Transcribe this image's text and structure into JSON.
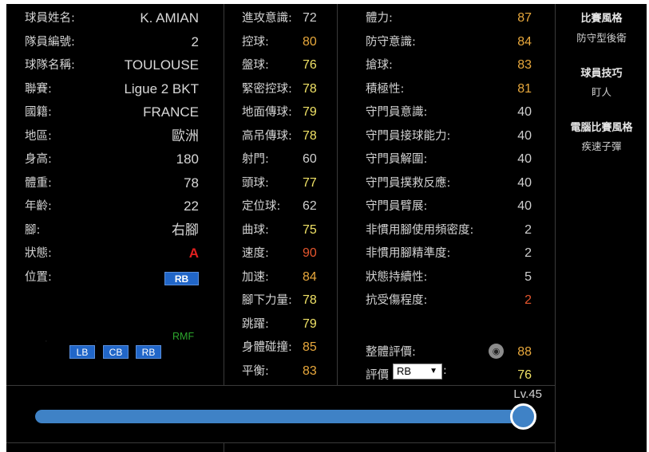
{
  "player_info": [
    {
      "label": "球員姓名:",
      "value": "K. AMIAN"
    },
    {
      "label": "隊員編號:",
      "value": "2"
    },
    {
      "label": "球隊名稱:",
      "value": "TOULOUSE"
    },
    {
      "label": "聯賽:",
      "value": "Ligue 2 BKT"
    },
    {
      "label": "國籍:",
      "value": "FRANCE"
    },
    {
      "label": "地區:",
      "value": "歐洲"
    },
    {
      "label": "身高:",
      "value": "180"
    },
    {
      "label": "體重:",
      "value": "78"
    },
    {
      "label": "年齡:",
      "value": "22"
    },
    {
      "label": "腳:",
      "value": "右腳"
    },
    {
      "label": "狀態:",
      "value": "A"
    },
    {
      "label": "位置:",
      "value": "RB"
    }
  ],
  "positions": {
    "highlight": "RMF",
    "badges": [
      "LB",
      "CB",
      "RB"
    ]
  },
  "attack_stats": [
    {
      "label": "進攻意識:",
      "value": "72"
    },
    {
      "label": "控球:",
      "value": "80"
    },
    {
      "label": "盤球:",
      "value": "76"
    },
    {
      "label": "緊密控球:",
      "value": "78"
    },
    {
      "label": "地面傳球:",
      "value": "79"
    },
    {
      "label": "高吊傳球:",
      "value": "78"
    },
    {
      "label": "射門:",
      "value": "60"
    },
    {
      "label": "頭球:",
      "value": "77"
    },
    {
      "label": "定位球:",
      "value": "62"
    },
    {
      "label": "曲球:",
      "value": "75"
    },
    {
      "label": "速度:",
      "value": "90"
    },
    {
      "label": "加速:",
      "value": "84"
    },
    {
      "label": "腳下力量:",
      "value": "78"
    },
    {
      "label": "跳躍:",
      "value": "79"
    },
    {
      "label": "身體碰撞:",
      "value": "85"
    },
    {
      "label": "平衡:",
      "value": "83"
    }
  ],
  "defense_stats": [
    {
      "label": "體力:",
      "value": "87"
    },
    {
      "label": "防守意識:",
      "value": "84"
    },
    {
      "label": "搶球:",
      "value": "83"
    },
    {
      "label": "積極性:",
      "value": "81"
    },
    {
      "label": "守門員意識:",
      "value": "40"
    },
    {
      "label": "守門員接球能力:",
      "value": "40"
    },
    {
      "label": "守門員解圍:",
      "value": "40"
    },
    {
      "label": "守門員撲救反應:",
      "value": "40"
    },
    {
      "label": "守門員臂展:",
      "value": "40"
    },
    {
      "label": "非慣用腳使用頻密度:",
      "value": "2"
    },
    {
      "label": "非慣用腳精準度:",
      "value": "2"
    },
    {
      "label": "狀態持續性:",
      "value": "5"
    },
    {
      "label": "抗受傷程度:",
      "value": "2"
    }
  ],
  "overall": {
    "label": "整體評價:",
    "value": "88"
  },
  "rating": {
    "label": "評價",
    "selected": "RB",
    "colon": ":",
    "value": "76"
  },
  "level": {
    "label": "Lv.45",
    "fraction": 1.0
  },
  "side": {
    "play_style_title": "比賽風格",
    "play_style": "防守型後衛",
    "skills_title": "球員技巧",
    "skills": "盯人",
    "com_style_title": "電腦比賽風格",
    "com_style": "疾速子彈"
  },
  "colors": {
    "high": "#f0e266",
    "mid": "#e8a83c",
    "red": "#e6562e",
    "accent": "#3f82c6",
    "badge": "#2166c8",
    "highlight_pos": "#2ca62c"
  }
}
